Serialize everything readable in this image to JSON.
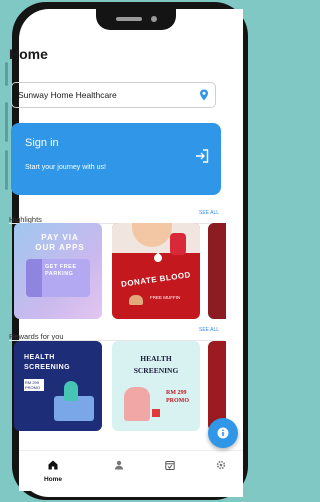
{
  "header": {
    "title": "Home"
  },
  "location": {
    "value": "Sunway Home Healthcare",
    "icon": "location-pin-icon"
  },
  "signin_card": {
    "title": "Sign in",
    "subtitle": "Start your journey with us!",
    "icon": "login-arrow-icon"
  },
  "highlights": {
    "label": "Highlights",
    "see_all": "SEE ALL",
    "cards": [
      {
        "title": "PAY VIA OUR APPS",
        "badge": "GET FREE PARKING"
      },
      {
        "title": "DONATE BLOOD",
        "badge": "FREE MUFFIN"
      }
    ]
  },
  "rewards": {
    "label": "Rewards for you",
    "see_all": "SEE ALL",
    "cards": [
      {
        "title": "HEALTH SCREENING",
        "promo": "RM 299 PROMO"
      },
      {
        "title": "HEALTH SCREENING",
        "promo": "RM 299 PROMO"
      }
    ]
  },
  "bottom_nav": {
    "items": [
      {
        "label": "Home",
        "icon": "home-icon",
        "active": true
      },
      {
        "label": "",
        "icon": "profile-icon",
        "active": false
      },
      {
        "label": "",
        "icon": "calendar-icon",
        "active": false
      },
      {
        "label": "",
        "icon": "settings-icon",
        "active": false
      }
    ]
  },
  "colors": {
    "accent": "#2f96e8",
    "background": "#7fc8c4",
    "link": "#3a8de0"
  }
}
